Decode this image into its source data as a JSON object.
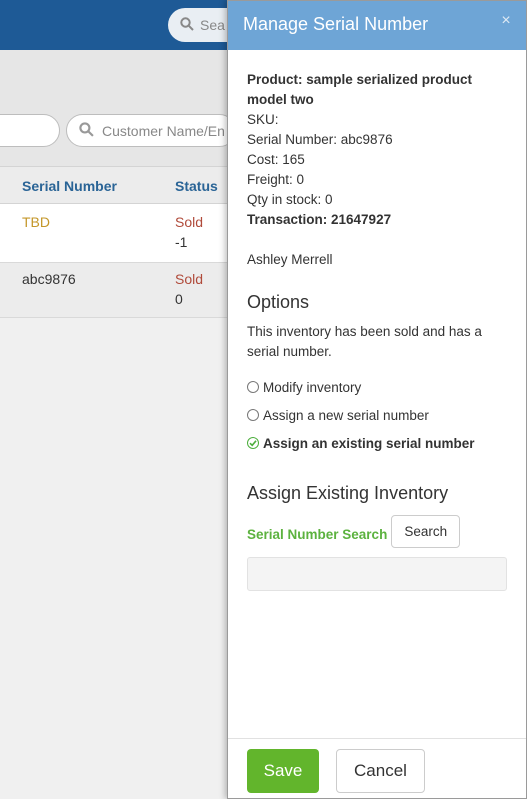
{
  "background": {
    "top_search_placeholder": "Sea",
    "filter_placeholder": "Customer Name/En",
    "columns": [
      "Serial Number",
      "Status"
    ],
    "rows": [
      {
        "serial": "TBD",
        "status": "Sold",
        "qty": "-1"
      },
      {
        "serial": "abc9876",
        "status": "Sold",
        "qty": "0"
      }
    ]
  },
  "modal": {
    "title": "Manage Serial Number",
    "close_glyph": "×",
    "product_line": "Product: sample serialized product model two",
    "sku_line": "SKU:",
    "serial_line": "Serial Number: abc9876",
    "cost_line": "Cost: 165",
    "freight_line": "Freight: 0",
    "qty_line": "Qty in stock: 0",
    "transaction_line": "Transaction: 21647927",
    "customer": "Ashley Merrell",
    "options_title": "Options",
    "options_desc": "This inventory has been sold and has a serial number.",
    "radio_options": [
      {
        "label": "Modify inventory",
        "checked": false
      },
      {
        "label": "Assign a new serial number",
        "checked": false
      },
      {
        "label": "Assign an existing serial number",
        "checked": true
      }
    ],
    "assign_title": "Assign Existing Inventory",
    "search_label": "Serial Number Search",
    "search_button": "Search",
    "search_value": "",
    "save_button": "Save",
    "cancel_button": "Cancel"
  },
  "colors": {
    "header_blue": "#1e5a96",
    "modal_header": "#6ea5d6",
    "accent_green": "#62b52c",
    "status_red": "#b04a3a",
    "tbd_gold": "#c4972a"
  }
}
